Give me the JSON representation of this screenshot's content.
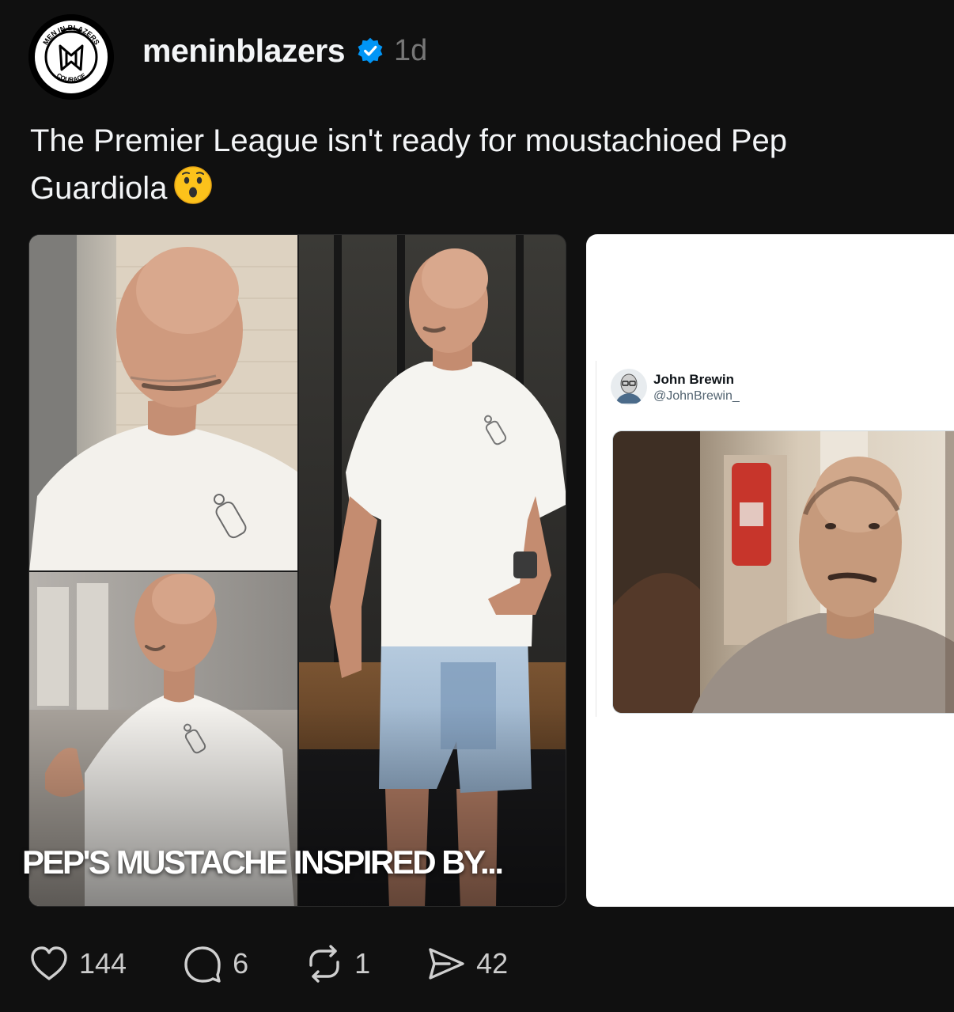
{
  "post": {
    "username": "meninblazers",
    "timestamp": "1d",
    "caption": "The Premier League isn't ready for moustachioed Pep Guardiola",
    "caption_emoji": "hushed-face-emoji",
    "avatar": {
      "icon": "men-in-blazers-logo",
      "logo_text_top": "MEN IN BLAZERS",
      "logo_text_bottom": "COURAGE"
    },
    "verified_icon": "verified-badge-icon",
    "colors": {
      "background": "#101010",
      "verified": "#0095f6",
      "secondary_text": "#777777"
    }
  },
  "media": [
    {
      "type": "photo-collage",
      "overlay_text": "PEP'S MUSTACHE INSPIRED BY..."
    },
    {
      "type": "tweet-screenshot",
      "tweet": {
        "author_name": "John Brewin",
        "author_handle": "@JohnBrewin_"
      }
    }
  ],
  "actions": {
    "like": {
      "icon": "heart-icon",
      "count": "144"
    },
    "comment": {
      "icon": "comment-icon",
      "count": "6"
    },
    "repost": {
      "icon": "repost-icon",
      "count": "1"
    },
    "share": {
      "icon": "send-icon",
      "count": "42"
    }
  }
}
